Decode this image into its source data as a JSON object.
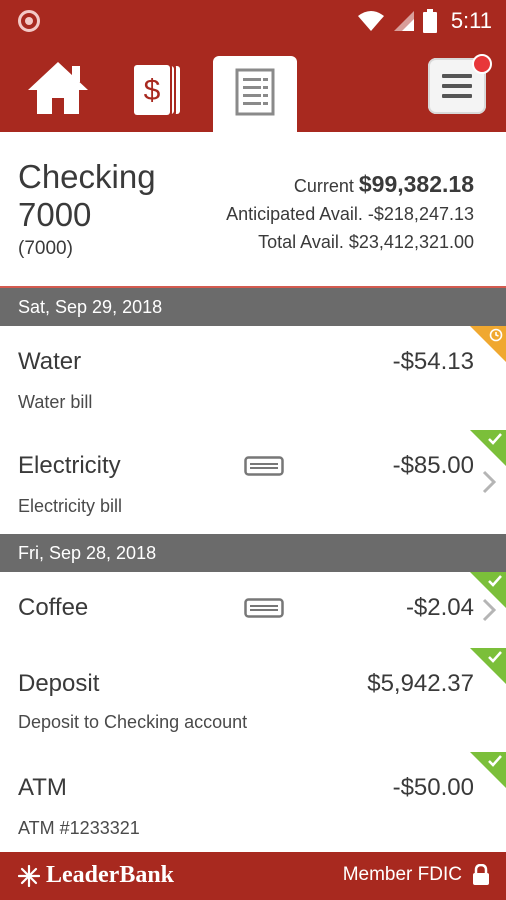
{
  "status_bar": {
    "time": "5:11"
  },
  "nav": {
    "items": [
      {
        "name": "home",
        "icon": "home-icon"
      },
      {
        "name": "money",
        "icon": "dollar-cards-icon"
      },
      {
        "name": "documents",
        "icon": "document-icon",
        "active": true
      },
      {
        "name": "menu",
        "icon": "menu-icon",
        "has_notification": true
      }
    ]
  },
  "account": {
    "name": "Checking 7000",
    "number": "(7000)",
    "current_label": "Current",
    "current_value": "$99,382.18",
    "anticipated": "Anticipated Avail. -$218,247.13",
    "total": "Total Avail. $23,412,321.00"
  },
  "groups": [
    {
      "date": "Sat, Sep 29, 2018",
      "transactions": [
        {
          "title": "Water",
          "description": "Water bill",
          "amount": "-$54.13",
          "status": "pending"
        },
        {
          "title": "Electricity",
          "description": "Electricity bill",
          "amount": "-$85.00",
          "status": "cleared",
          "card": true
        }
      ]
    },
    {
      "date": "Fri, Sep 28, 2018",
      "transactions": [
        {
          "title": "Coffee",
          "description": "",
          "amount": "-$2.04",
          "status": "cleared",
          "card": true
        },
        {
          "title": "Deposit",
          "description": "Deposit to Checking account",
          "amount": "$5,942.37",
          "status": "cleared"
        },
        {
          "title": "ATM",
          "description": "ATM #1233321",
          "amount": "-$50.00",
          "status": "cleared"
        }
      ]
    }
  ],
  "footer": {
    "brand": "LeaderBank",
    "fdic": "Member FDIC"
  },
  "colors": {
    "brand_red": "#a8291f",
    "date_header_gray": "#6b6b6b",
    "cleared_green": "#7bbf3a",
    "pending_orange": "#f0a830"
  }
}
